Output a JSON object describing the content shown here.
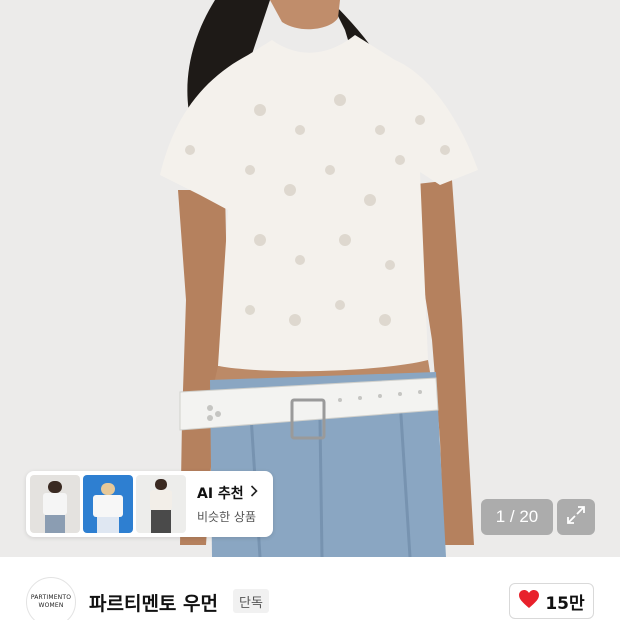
{
  "gallery": {
    "counter": "1 / 20",
    "current_image": 1,
    "total_images": 20
  },
  "ai_recommend": {
    "title": "AI 추천",
    "subtitle": "비슷한 상품"
  },
  "brand": {
    "logo_line1": "PARTIMENTO",
    "logo_line2": "WOMEN",
    "name": "파르티멘토 우먼",
    "badge": "단독"
  },
  "like": {
    "count": "15만",
    "heart_color": "#e8212b"
  },
  "icons": [
    "chevron-right-icon",
    "expand-icon",
    "heart-icon"
  ]
}
